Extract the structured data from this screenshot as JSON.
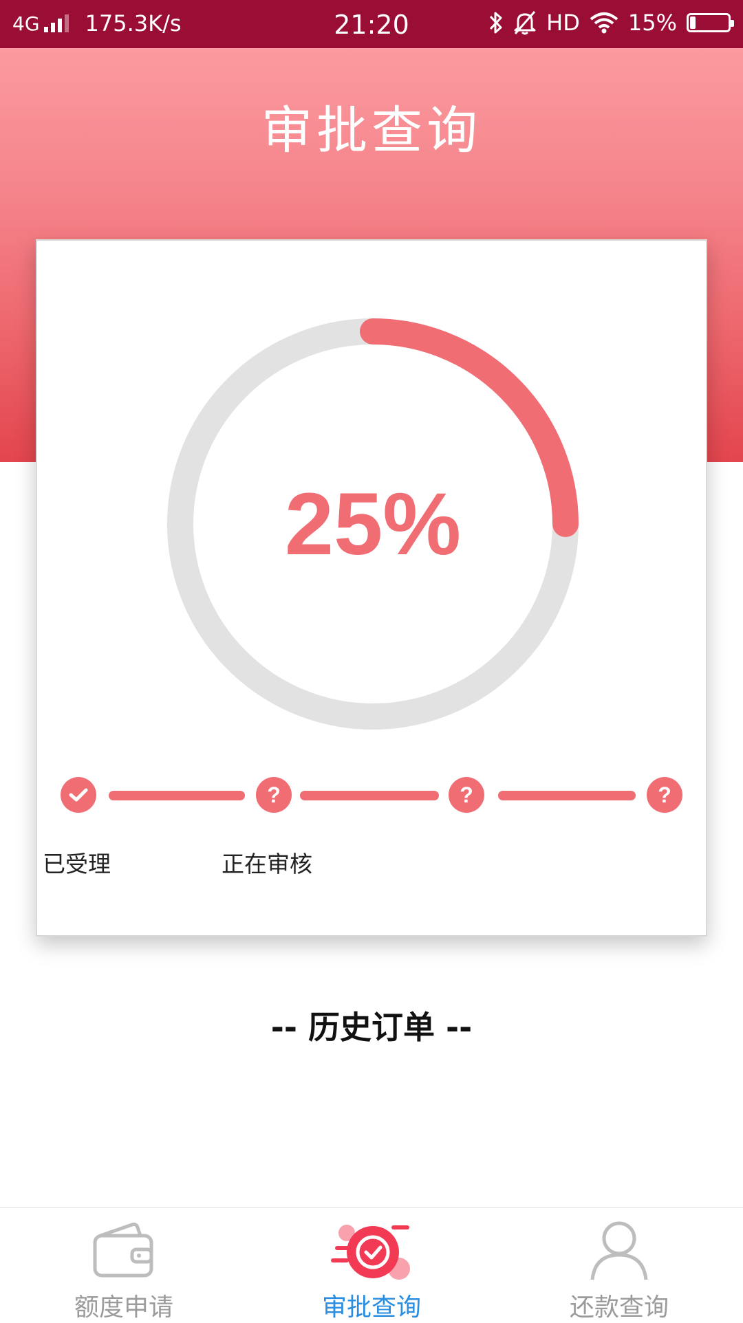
{
  "status_bar": {
    "network": "4G",
    "speed": "175.3K/s",
    "time": "21:20",
    "hd": "HD",
    "battery": "15%",
    "battery_level": 0.15,
    "icons": [
      "signal-icon",
      "bluetooth-icon",
      "mute-icon",
      "wifi-icon",
      "battery-icon"
    ]
  },
  "header": {
    "title": "审批查询"
  },
  "progress": {
    "value_text": "25%",
    "value": 0.25,
    "color": "#f06d73",
    "track_color": "#e2e2e2"
  },
  "steps": [
    {
      "label": "已受理",
      "status": "done",
      "icon": "check-icon"
    },
    {
      "label": "正在审核",
      "status": "pending",
      "icon": "?"
    },
    {
      "label": "",
      "status": "pending",
      "icon": "?"
    },
    {
      "label": "",
      "status": "pending",
      "icon": "?"
    }
  ],
  "history": {
    "title": "-- 历史订单 --"
  },
  "bottom_nav": {
    "items": [
      {
        "label": "额度申请",
        "icon": "wallet-icon",
        "active": false
      },
      {
        "label": "审批查询",
        "icon": "approval-check-icon",
        "active": true
      },
      {
        "label": "还款查询",
        "icon": "user-icon",
        "active": false
      }
    ],
    "active_color": "#2a8de0",
    "inactive_color": "#9b9b9b"
  }
}
